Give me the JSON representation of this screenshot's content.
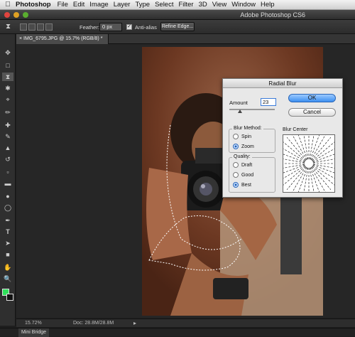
{
  "menubar": {
    "apple": "",
    "items": [
      "Photoshop",
      "File",
      "Edit",
      "Image",
      "Layer",
      "Type",
      "Select",
      "Filter",
      "3D",
      "View",
      "Window",
      "Help"
    ]
  },
  "window": {
    "title": "Adobe Photoshop CS6"
  },
  "options": {
    "feather_label": "Feather:",
    "feather_value": "0 px",
    "antialias_label": "Anti-alias",
    "refine_edge_label": "Refine Edge..."
  },
  "document": {
    "tab": "IMG_6795.JPG @ 15.7% (RGB/8) *"
  },
  "status": {
    "zoom": "15.72%",
    "doc": "Doc: 28.8M/28.8M"
  },
  "panel": {
    "mini_bridge": "Mini Bridge"
  },
  "colors": {
    "foreground": "#2fe05a",
    "background": "#111111"
  },
  "dialog": {
    "title": "Radial Blur",
    "amount_label": "Amount",
    "amount_value": "23",
    "ok_label": "OK",
    "cancel_label": "Cancel",
    "blur_method_title": "Blur Method:",
    "blur_methods": [
      "Spin",
      "Zoom"
    ],
    "blur_method_selected": "Zoom",
    "quality_title": "Quality:",
    "qualities": [
      "Draft",
      "Good",
      "Best"
    ],
    "quality_selected": "Best",
    "blur_center_label": "Blur Center"
  },
  "tools": [
    "move-icon",
    "marquee-icon",
    "lasso-icon",
    "quick-select-icon",
    "crop-icon",
    "eyedropper-icon",
    "healing-icon",
    "brush-icon",
    "clone-stamp-icon",
    "history-brush-icon",
    "eraser-icon",
    "gradient-icon",
    "blur-icon",
    "dodge-icon",
    "pen-icon",
    "type-icon",
    "path-select-icon",
    "shape-icon",
    "hand-icon",
    "zoom-icon"
  ]
}
